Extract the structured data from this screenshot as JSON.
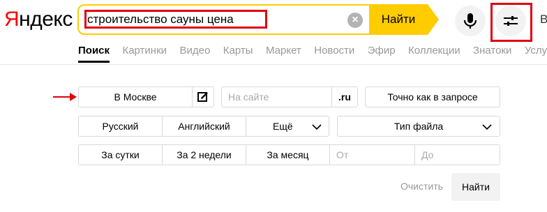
{
  "header": {
    "logo_first": "Я",
    "logo_rest": "ндекс",
    "query": "строительство сауны цена",
    "find_label": "Найти",
    "cut_text": "В"
  },
  "tabs": [
    {
      "label": "Поиск",
      "active": true
    },
    {
      "label": "Картинки"
    },
    {
      "label": "Видео"
    },
    {
      "label": "Карты"
    },
    {
      "label": "Маркет"
    },
    {
      "label": "Новости"
    },
    {
      "label": "Эфир"
    },
    {
      "label": "Коллекции"
    },
    {
      "label": "Знатоки"
    },
    {
      "label": "Услу"
    }
  ],
  "advanced": {
    "region_label": "В Москве",
    "site_placeholder": "На сайте",
    "domain_label": ".ru",
    "exact_label": "Точно как в запросе",
    "lang_russian": "Русский",
    "lang_english": "Английский",
    "lang_more": "Ещё",
    "file_type": "Тип файла",
    "period_day": "За сутки",
    "period_2weeks": "За 2 недели",
    "period_month": "За месяц",
    "from_placeholder": "От",
    "to_placeholder": "До",
    "clear_label": "Очистить",
    "submit_label": "Найти"
  },
  "colors": {
    "accent": "#ffcc00",
    "annotation": "#e0000b",
    "logo_red": "#ff0000"
  }
}
